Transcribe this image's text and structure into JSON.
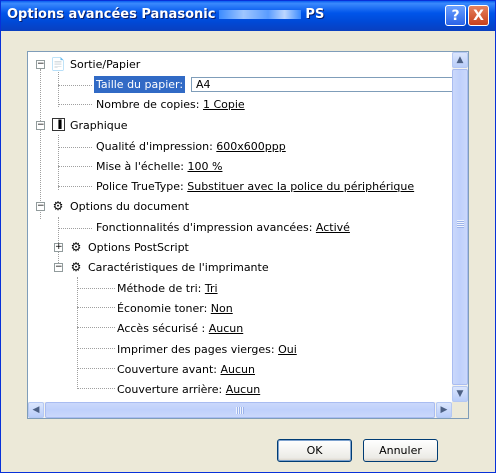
{
  "window": {
    "title_start": "Options avancées Panasonic",
    "title_end": "PS",
    "help_button": "?",
    "close_button": "X"
  },
  "tree": {
    "sortie": {
      "label": "Sortie/Papier",
      "taille_label": "Taille du papier:",
      "taille_value": "A4",
      "copies_label": "Nombre de copies:",
      "copies_value": "1 Copie"
    },
    "graphique": {
      "label": "Graphique",
      "qualite_label": "Qualité d'impression:",
      "qualite_value": "600x600ppp",
      "echelle_label": "Mise à l'échelle:",
      "echelle_value": "100 %",
      "police_label": "Police TrueType:",
      "police_value": "Substituer avec la police du périphérique"
    },
    "document": {
      "label": "Options du document",
      "fonctions_label": "Fonctionnalités d'impression avancées:",
      "fonctions_value": "Activé",
      "postscript_label": "Options PostScript",
      "caract_label": "Caractéristiques de l'imprimante",
      "tri_label": "Méthode de tri:",
      "tri_value": "Tri",
      "toner_label": "Économie toner:",
      "toner_value": "Non",
      "acces_label": "Accès sécurisé :",
      "acces_value": "Aucun",
      "vierges_label": "Imprimer des pages vierges:",
      "vierges_value": "Oui",
      "avant_label": "Couverture avant:",
      "avant_value": "Aucun",
      "arriere_label": "Couverture arrière:",
      "arriere_value": "Aucun"
    }
  },
  "buttons": {
    "ok": "OK",
    "cancel": "Annuler"
  }
}
